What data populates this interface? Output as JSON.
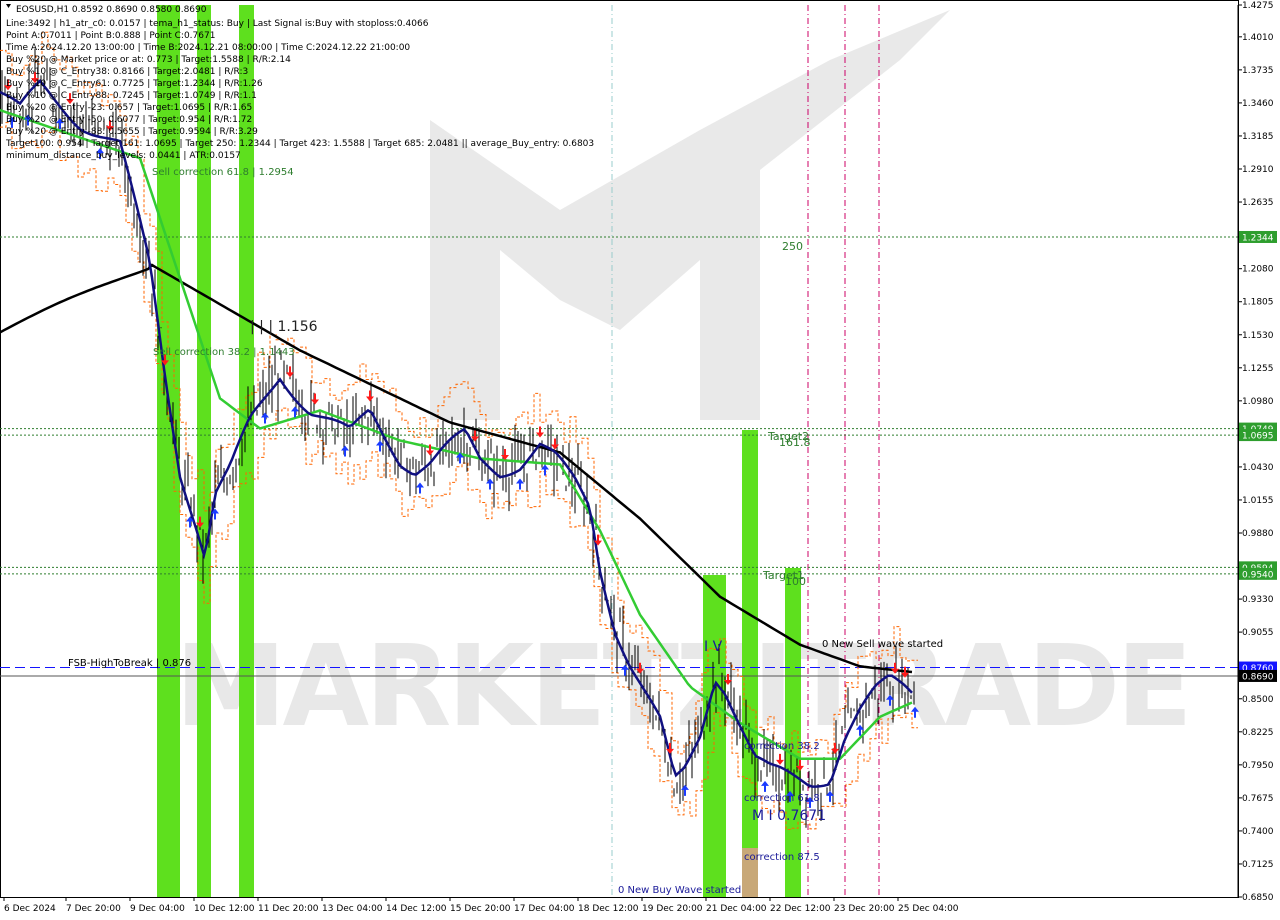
{
  "chart_data": {
    "type": "candlestick",
    "symbol": "EOSUSD,H1",
    "ohlc_header": "EOSUSD,H1  0.8592 0.8690 0.8580 0.8690",
    "ylim": [
      0.685,
      1.4275
    ],
    "y_ticks": [
      "1.4275",
      "1.4010",
      "1.3735",
      "1.3460",
      "1.3185",
      "1.2910",
      "1.2635",
      "1.2080",
      "1.1805",
      "1.1530",
      "1.1255",
      "1.0980",
      "1.0430",
      "1.0155",
      "0.9880",
      "0.9330",
      "0.9055",
      "0.8500",
      "0.8225",
      "0.7950",
      "0.7675",
      "0.7400",
      "0.7125",
      "0.6850"
    ],
    "x_ticks": [
      "6 Dec 2024",
      "7 Dec 20:00",
      "9 Dec 04:00",
      "10 Dec 12:00",
      "11 Dec 20:00",
      "13 Dec 04:00",
      "14 Dec 12:00",
      "15 Dec 20:00",
      "17 Dec 04:00",
      "18 Dec 12:00",
      "19 Dec 20:00",
      "21 Dec 04:00",
      "22 Dec 12:00",
      "23 Dec 20:00",
      "25 Dec 04:00"
    ],
    "price_levels": [
      {
        "label": "1.2344",
        "value": 1.2344,
        "bg": "#2e9e2e",
        "style": "dotted"
      },
      {
        "label": "1.0749",
        "value": 1.0749,
        "bg": "#2e9e2e",
        "style": "dotted"
      },
      {
        "label": "1.0695",
        "value": 1.0695,
        "bg": "#2e9e2e",
        "style": "dotted"
      },
      {
        "label": "0.9594",
        "value": 0.9594,
        "bg": "#2e9e2e",
        "style": "dotted"
      },
      {
        "label": "0.9540",
        "value": 0.954,
        "bg": "#2e9e2e",
        "style": "dotted"
      },
      {
        "label": "0.8760",
        "value": 0.876,
        "bg": "#1414ff",
        "style": "dashed"
      },
      {
        "label": "0.8690",
        "value": 0.869,
        "bg": "#000000",
        "style": "solid"
      }
    ],
    "info_lines": [
      "Line:3492 | h1_atr_c0: 0.0157 | tema_h1_status: Buy | Last Signal is:Buy with stoploss:0.4066",
      "Point A:0.7011 | Point B:0.888 | Point C:0.7671",
      "Time A:2024.12.20 13:00:00 | Time B:2024.12.21 08:00:00 | Time C:2024.12.22 21:00:00",
      "Buy %20 @ Market price or at: 0.773 | Target:1.5588 | R/R:2.14",
      "Buy %10 @ C_Entry38: 0.8166 | Target:2.0481 | R/R:3",
      "Buy %10 @ C_Entry61: 0.7725 | Target:1.2344 | R/R:1.26",
      "Buy %10 @ C_Entry88: 0.7245 | Target:1.0749 | R/R:1.1",
      "Buy %20 @ Entry -23: 0.657 | Target:1.0695 | R/R:1.65",
      "Buy %20 @ Entry -50: 0.6077 | Target:0.954 | R/R:1.72",
      "Buy %20 @ Entry -88: 0.5655 | Target:0.9594 | R/R:3.29",
      "Target100: 0.954 | Target 161: 1.0695 | Target 250: 1.2344 | Target 423: 1.5588 | Target 685: 2.0481 || average_Buy_entry: 0.6803",
      "minimum_distance_buy_levels: 0.0441 | ATR:0.0157"
    ],
    "annotations": [
      {
        "text": "Sell correction 61.8 | 1.2954",
        "color": "#2e7d2e",
        "size": 10
      },
      {
        "text": "| | | 1.156",
        "color": "#222222",
        "size": 14
      },
      {
        "text": "Sell correction 38.2 | 1.1443",
        "color": "#2e7d2e",
        "size": 10
      },
      {
        "text": "250",
        "color": "#2e7d2e",
        "size": 11
      },
      {
        "text": "Target2",
        "color": "#2e7d2e",
        "size": 11
      },
      {
        "text": "161.8",
        "color": "#2e7d2e",
        "size": 11
      },
      {
        "text": "Target1",
        "color": "#2e7d2e",
        "size": 11
      },
      {
        "text": "100",
        "color": "#2e7d2e",
        "size": 11
      },
      {
        "text": "0 New Sell wave started",
        "color": "#000000",
        "size": 10
      },
      {
        "text": "FSB-HighToBreak | 0.876",
        "color": "#000000",
        "size": 10
      },
      {
        "text": "I V",
        "color": "#1a1a99",
        "size": 14
      },
      {
        "text": "correction 38.2",
        "color": "#1a1a99",
        "size": 10
      },
      {
        "text": "correction 61.8",
        "color": "#1a1a99",
        "size": 10
      },
      {
        "text": "M I 0.7671",
        "color": "#1a1a99",
        "size": 14
      },
      {
        "text": "correction 87.5",
        "color": "#1a1a99",
        "size": 10
      },
      {
        "text": "0 New Buy Wave started",
        "color": "#1a1a99",
        "size": 10
      }
    ],
    "watermark": "MARKETZITRADE",
    "colors": {
      "green_bar": "#5ee01e",
      "tan_bar": "#c8a878",
      "ma_black": "#000000",
      "ma_green": "#33cc33",
      "ma_navy": "#101080",
      "envelope_orange": "#ff6600",
      "vline_magenta": "#cc0066",
      "vline_cyan": "#99cccc",
      "buy_arrow": "#1a3bff",
      "sell_arrow": "#ff1a1a"
    }
  }
}
